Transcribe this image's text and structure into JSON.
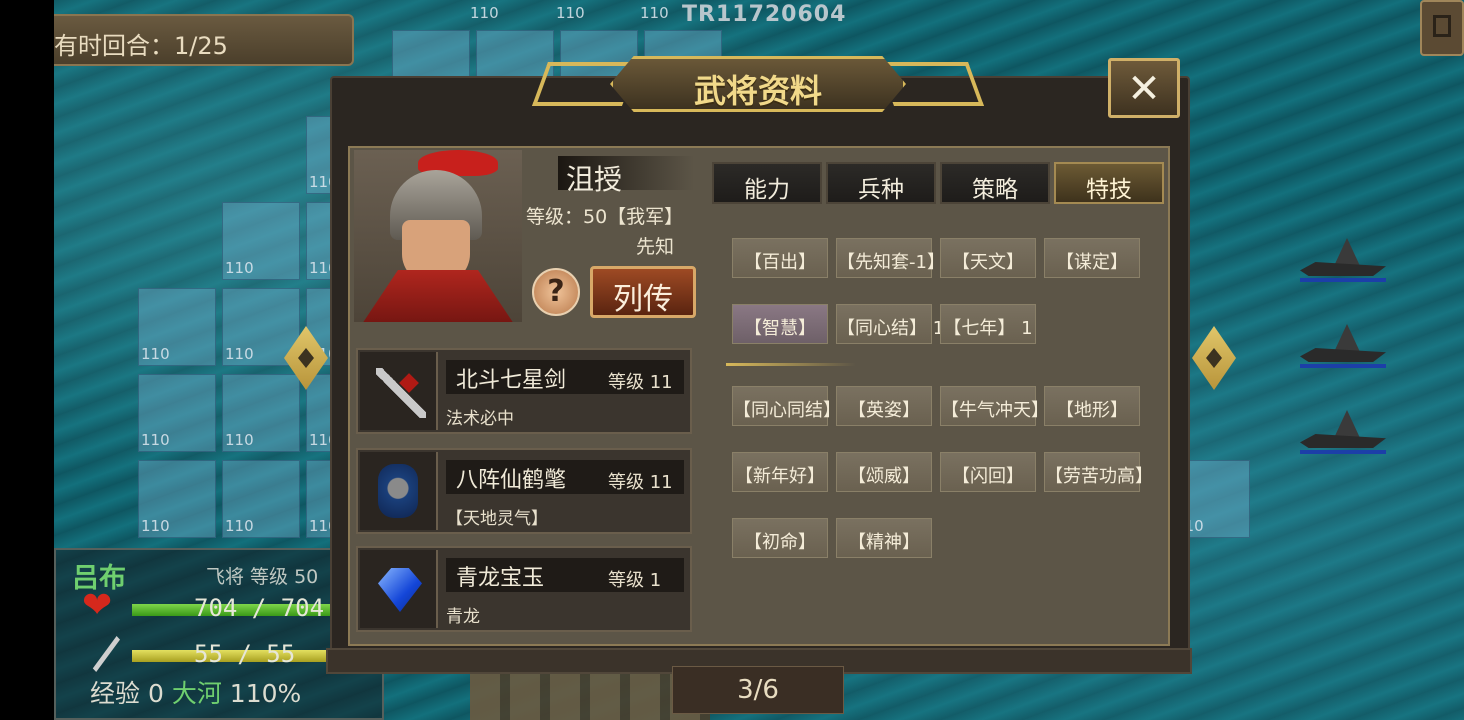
{
  "map": {
    "tile_label": "110",
    "map_id": "TR11720604",
    "turn_text": "有时回合：1/25"
  },
  "unit": {
    "name": "吕布",
    "class_level": "飞将 等级 50",
    "hp": "704 / 704",
    "mp": "55 / 55",
    "exp_label": "经验",
    "exp_value": "0",
    "terrain": "大河",
    "terrain_rate": "110%"
  },
  "dialog": {
    "title": "武将资料",
    "close_label": "✕",
    "page": "3/6"
  },
  "general": {
    "name": "沮授",
    "level": "等级：50【我军】",
    "skill": "先知",
    "help_label": "?",
    "bio_label": "列传"
  },
  "equipment": [
    {
      "name": "北斗七星剑",
      "level": "等级 11",
      "desc": "法术必中",
      "icon": "sword-icon"
    },
    {
      "name": "八阵仙鹤氅",
      "level": "等级 11",
      "desc": "【天地灵气】",
      "icon": "cloak-icon"
    },
    {
      "name": "青龙宝玉",
      "level": "等级 1",
      "desc": "青龙",
      "icon": "jade-icon"
    }
  ],
  "tabs": [
    "能力",
    "兵种",
    "策略",
    "特技"
  ],
  "active_tab": "特技",
  "skills_top": [
    [
      "【百出】",
      "【先知套-1】",
      "【天文】",
      "【谋定】"
    ],
    [
      "【智慧】",
      "【同心结】 1",
      "【七年】 1"
    ]
  ],
  "skills_bottom": [
    [
      "【同心同结】",
      "【英姿】",
      "【牛气冲天】",
      "【地形】"
    ],
    [
      "【新年好】",
      "【颂威】",
      "【闪回】",
      "【劳苦功高】"
    ],
    [
      "【初命】",
      "【精神】"
    ]
  ],
  "colors": {
    "gold": "#d7b85a",
    "panel": "#5c5547",
    "hp_green": "#6fcf6f"
  }
}
